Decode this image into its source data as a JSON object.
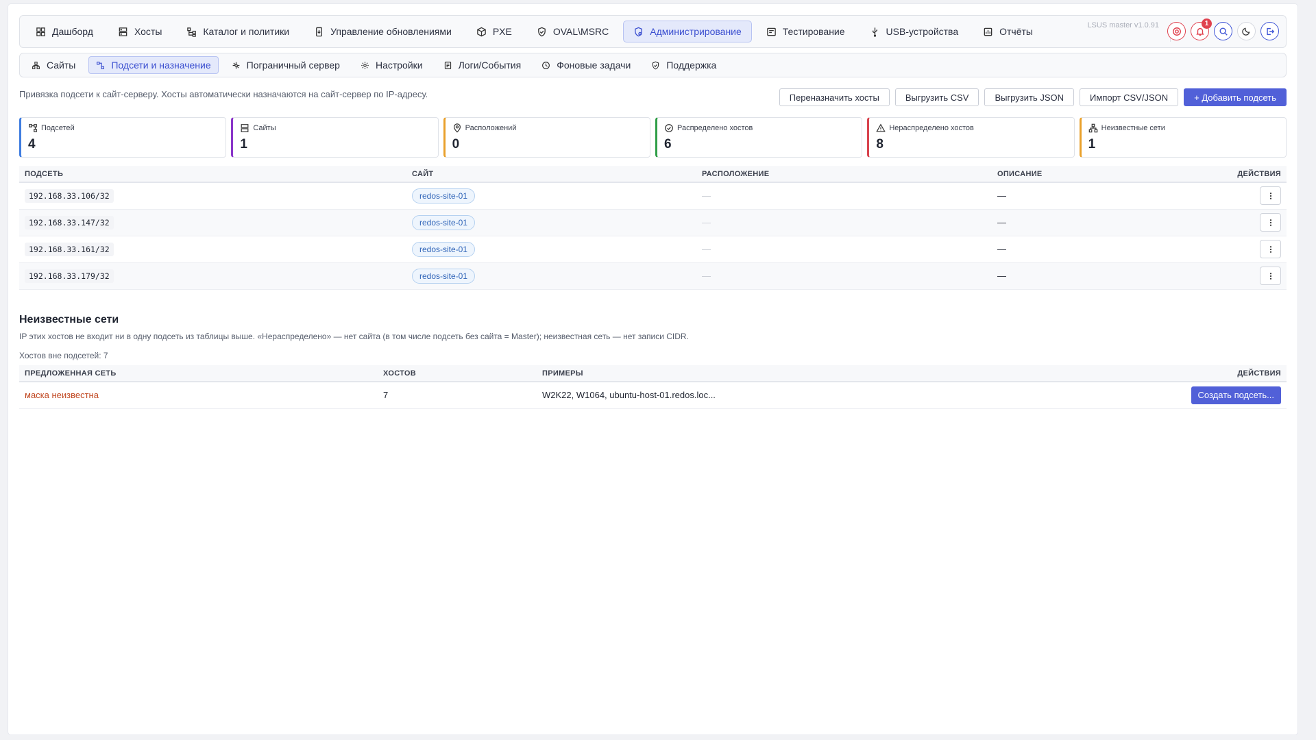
{
  "nav": {
    "items": [
      {
        "label": "Дашборд",
        "icon": "dashboard-icon"
      },
      {
        "label": "Хосты",
        "icon": "server-icon"
      },
      {
        "label": "Каталог и политики",
        "icon": "hierarchy-icon"
      },
      {
        "label": "Управление обновлениями",
        "icon": "update-icon"
      },
      {
        "label": "PXE",
        "icon": "cube-icon"
      },
      {
        "label": "OVAL\\MSRC",
        "icon": "shield-check-icon"
      },
      {
        "label": "Администрирование",
        "icon": "admin-icon",
        "active": true
      },
      {
        "label": "Тестирование",
        "icon": "test-icon"
      },
      {
        "label": "USB-устройства",
        "icon": "usb-icon"
      },
      {
        "label": "Отчёты",
        "icon": "report-icon"
      }
    ],
    "version": "LSUS master v1.0.91",
    "notifications_count": "1"
  },
  "subnav": {
    "items": [
      {
        "label": "Сайты",
        "icon": "sites-icon"
      },
      {
        "label": "Подсети и назначение",
        "icon": "subnet-icon",
        "active": true
      },
      {
        "label": "Пограничный сервер",
        "icon": "edge-server-icon"
      },
      {
        "label": "Настройки",
        "icon": "settings-icon"
      },
      {
        "label": "Логи/События",
        "icon": "log-icon"
      },
      {
        "label": "Фоновые задачи",
        "icon": "clock-icon"
      },
      {
        "label": "Поддержка",
        "icon": "support-icon"
      }
    ]
  },
  "page": {
    "description": "Привязка подсети к сайт-серверу. Хосты автоматически назначаются на сайт-сервер по IP-адресу.",
    "buttons": {
      "reassign": "Переназначить хосты",
      "export_csv": "Выгрузить CSV",
      "export_json": "Выгрузить JSON",
      "import": "Импорт CSV/JSON",
      "add": "+ Добавить подсеть"
    }
  },
  "stats": [
    {
      "label": "Подсетей",
      "value": "4",
      "color": "#3f7de0",
      "icon": "subnet-icon"
    },
    {
      "label": "Сайты",
      "value": "1",
      "color": "#8a35c9",
      "icon": "server-icon"
    },
    {
      "label": "Расположений",
      "value": "0",
      "color": "#e9a02b",
      "icon": "location-icon"
    },
    {
      "label": "Распределено хостов",
      "value": "6",
      "color": "#2f9e47",
      "icon": "check-circle-icon"
    },
    {
      "label": "Нераспределено хостов",
      "value": "8",
      "color": "#d8434e",
      "icon": "warning-icon"
    },
    {
      "label": "Неизвестные сети",
      "value": "1",
      "color": "#e9a02b",
      "icon": "network-icon"
    }
  ],
  "subnets": {
    "headers": [
      "ПОДСЕТЬ",
      "САЙТ",
      "РАСПОЛОЖЕНИЕ",
      "ОПИСАНИЕ",
      "ДЕЙСТВИЯ"
    ],
    "rows": [
      {
        "subnet": "192.168.33.106/32",
        "site": "redos-site-01",
        "location": "—",
        "description": "—"
      },
      {
        "subnet": "192.168.33.147/32",
        "site": "redos-site-01",
        "location": "—",
        "description": "—"
      },
      {
        "subnet": "192.168.33.161/32",
        "site": "redos-site-01",
        "location": "—",
        "description": "—"
      },
      {
        "subnet": "192.168.33.179/32",
        "site": "redos-site-01",
        "location": "—",
        "description": "—"
      }
    ]
  },
  "unknown": {
    "title": "Неизвестные сети",
    "description": "IP этих хостов не входит ни в одну подсеть из таблицы выше. «Нераспределено» — нет сайта (в том числе подсеть без сайта = Master); неизвестная сеть — нет записи CIDR.",
    "count_text": "Хостов вне подсетей: 7",
    "headers": [
      "ПРЕДЛОЖЕННАЯ СЕТЬ",
      "ХОСТОВ",
      "ПРИМЕРЫ",
      "ДЕЙСТВИЯ"
    ],
    "rows": [
      {
        "network": "маска неизвестна",
        "hosts": "7",
        "examples": "W2K22, W1064, ubuntu-host-01.redos.loc...",
        "action": "Создать подсеть..."
      }
    ]
  }
}
